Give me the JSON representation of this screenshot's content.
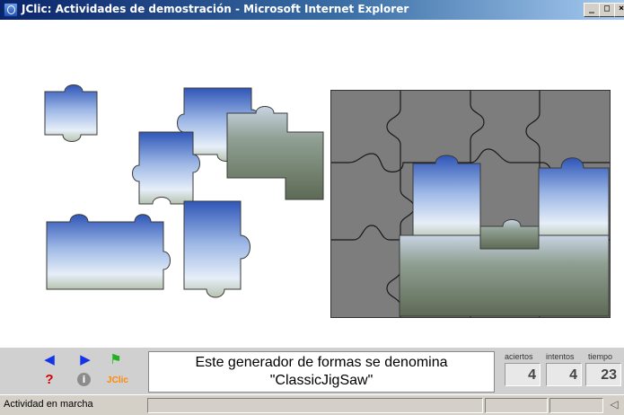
{
  "window": {
    "title": "JClic: Actividades de demostración - Microsoft Internet Explorer",
    "buttons": {
      "minimize": "_",
      "maximize": "□",
      "close": "×"
    }
  },
  "activity": {
    "message": "Este generador de formas se denomina \"ClassicJigSaw\""
  },
  "counters": {
    "aciertos_label": "aciertos",
    "aciertos_value": "4",
    "intentos_label": "intentos",
    "intentos_value": "4",
    "tiempo_label": "tiempo",
    "tiempo_value": "23"
  },
  "toolbar": {
    "prev_icon": "arrow-left-icon",
    "next_icon": "arrow-right-icon",
    "reports_icon": "flag-icon",
    "help_icon": "question-icon",
    "info_icon": "info-icon",
    "jclic_label": "JClic"
  },
  "status": {
    "text": "Actividad en marcha",
    "sound_icon": "speaker-icon"
  },
  "colors": {
    "titlebar": "#0a246a",
    "board": "#7d7d7d",
    "bottom_panel": "#d0d0d0",
    "arrows": "#1434e8",
    "flag": "#1eb41e",
    "help": "#d40000",
    "jclic": "#ff8a00"
  }
}
